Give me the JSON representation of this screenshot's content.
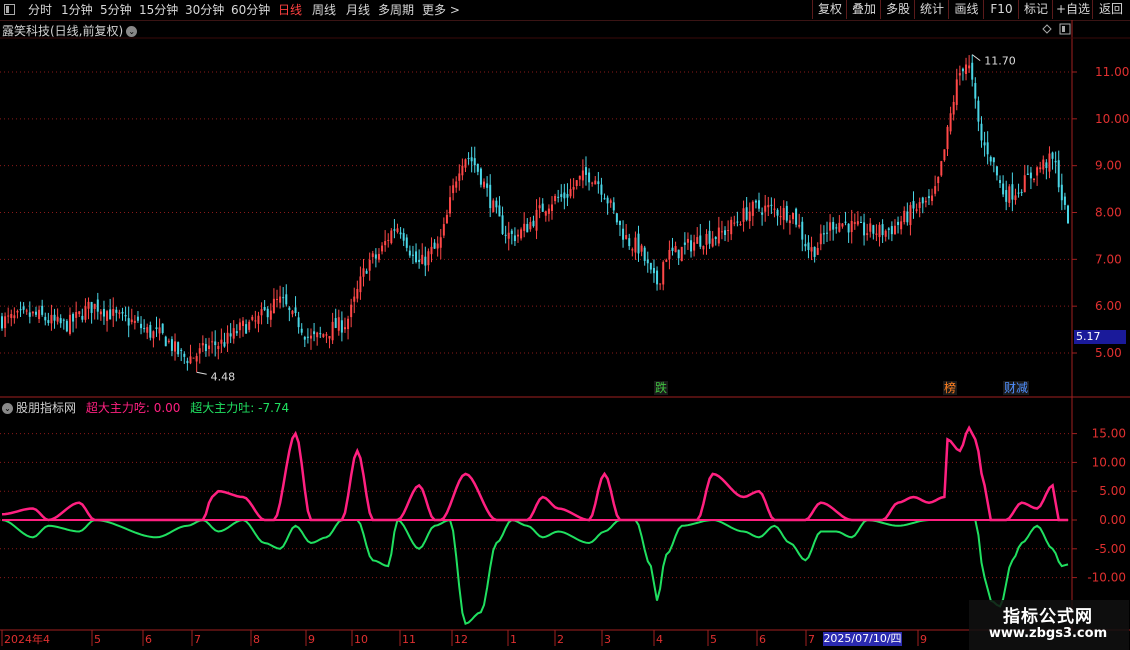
{
  "toolbar": {
    "periods": [
      "分时",
      "1分钟",
      "5分钟",
      "15分钟",
      "30分钟",
      "60分钟",
      "日线",
      "周线",
      "月线",
      "多周期",
      "更多 >"
    ],
    "active_period": "日线",
    "right_buttons": [
      "复权",
      "叠加",
      "多股",
      "统计",
      "画线",
      "F10",
      "标记",
      "+自选",
      "返回"
    ]
  },
  "main_chart": {
    "title": "露笑科技(日线,前复权)",
    "high_label": "11.70",
    "low_label": "4.48",
    "last_price": "5.17",
    "y_ticks": [
      "11.00",
      "10.00",
      "9.00",
      "8.00",
      "7.00",
      "6.00",
      "5.00"
    ],
    "markers": [
      "跌",
      "榜",
      "财减"
    ]
  },
  "indicator": {
    "name": "股朋指标网",
    "series1_label": "超大主力吃: 0.00",
    "series2_label": "超大主力吐: -7.74",
    "y_ticks": [
      "15.00",
      "10.00",
      "5.00",
      "0.00",
      "-5.00",
      "-10.00"
    ]
  },
  "x_axis": {
    "labels": [
      "2024年4",
      "5",
      "6",
      "7",
      "8",
      "9",
      "10",
      "11",
      "12",
      "1",
      "2",
      "3",
      "4",
      "5",
      "6",
      "7",
      "9"
    ],
    "highlight_date": "2025/07/10/四"
  },
  "watermark": {
    "title": "指标公式网",
    "url": "www.zbgs3.com"
  },
  "colors": {
    "up": "#ff4848",
    "down": "#4ad6e6",
    "series1": "#ff2080",
    "series2": "#20e060",
    "grid": "#8a1a1a"
  },
  "chart_data": [
    {
      "type": "candlestick",
      "title": "露笑科技(日线,前复权)",
      "ylim": [
        4.3,
        12.0
      ],
      "close_anchors": {
        "x_index": [
          0,
          10,
          20,
          30,
          40,
          50,
          60,
          70,
          80,
          90,
          95,
          100,
          110,
          120,
          128,
          135,
          140,
          150,
          165,
          180,
          190,
          205,
          212,
          215,
          230,
          245,
          255,
          262,
          270,
          280,
          285,
          300,
          312,
          318,
          325,
          340,
          345
        ],
        "close": [
          5.7,
          5.8,
          5.6,
          6.0,
          5.7,
          5.4,
          4.9,
          5.2,
          5.6,
          6.1,
          5.7,
          5.3,
          5.6,
          7.0,
          7.7,
          6.9,
          7.2,
          9.2,
          7.5,
          8.3,
          8.8,
          7.3,
          6.5,
          7.1,
          7.5,
          8.1,
          8.0,
          7.2,
          7.8,
          7.6,
          7.6,
          8.2,
          11.2,
          9.4,
          8.4,
          9.1,
          7.9
        ]
      },
      "high": 11.7,
      "low": 4.48,
      "last": 5.17
    },
    {
      "type": "line",
      "series": [
        {
          "name": "超大主力吃",
          "last": 0.0,
          "anchors_x": [
            0,
            10,
            15,
            25,
            30,
            50,
            60,
            65,
            68,
            70,
            78,
            85,
            88,
            95,
            100,
            110,
            115,
            120,
            128,
            135,
            140,
            142,
            150,
            160,
            170,
            175,
            180,
            190,
            195,
            200,
            205,
            220,
            225,
            230,
            240,
            245,
            250,
            260,
            265,
            275,
            280,
            285,
            290,
            295,
            300,
            305,
            306,
            310,
            313,
            315,
            318,
            320,
            325,
            330,
            335,
            340,
            342,
            345
          ],
          "anchors_y": [
            1,
            2,
            0,
            3,
            0,
            0,
            0,
            0,
            4,
            5,
            4,
            0,
            0,
            15,
            0,
            0,
            12,
            0,
            0,
            6,
            0,
            0,
            8,
            0,
            0,
            4,
            2,
            0,
            8,
            0,
            0,
            0,
            0,
            8,
            4,
            5,
            0,
            0,
            3,
            0,
            0,
            0,
            3,
            4,
            3,
            4,
            14,
            12,
            16,
            14,
            6,
            0,
            0,
            3,
            2,
            6,
            0,
            0
          ]
        },
        {
          "name": "超大主力吐",
          "last": -7.74,
          "anchors_x": [
            0,
            10,
            15,
            25,
            30,
            50,
            60,
            65,
            70,
            78,
            85,
            90,
            95,
            100,
            105,
            110,
            115,
            120,
            125,
            128,
            135,
            140,
            145,
            150,
            155,
            160,
            165,
            170,
            175,
            180,
            190,
            195,
            200,
            205,
            210,
            212,
            215,
            220,
            230,
            240,
            245,
            250,
            255,
            260,
            265,
            270,
            275,
            280,
            290,
            300,
            305,
            310,
            315,
            318,
            320,
            323,
            327,
            330,
            335,
            340,
            343,
            345
          ],
          "anchors_y": [
            0,
            -3,
            -1,
            -2,
            0,
            -3,
            -1,
            0,
            -2,
            0,
            -4,
            -5,
            -1,
            -4,
            -3,
            0,
            0,
            -7,
            -8,
            0,
            -5,
            -1,
            0,
            -18,
            -16,
            -4,
            0,
            -1,
            -3,
            -2,
            -4,
            -2,
            0,
            0,
            -8,
            -14,
            -6,
            -1,
            0,
            -2,
            -3,
            -1,
            -4,
            -7,
            -2,
            -2,
            -3,
            0,
            -1,
            0,
            0,
            0,
            0,
            -10,
            -14,
            -15,
            -7,
            -4,
            -1,
            -5,
            -8,
            -7.7
          ]
        }
      ],
      "ylim": [
        -19,
        20
      ]
    }
  ]
}
